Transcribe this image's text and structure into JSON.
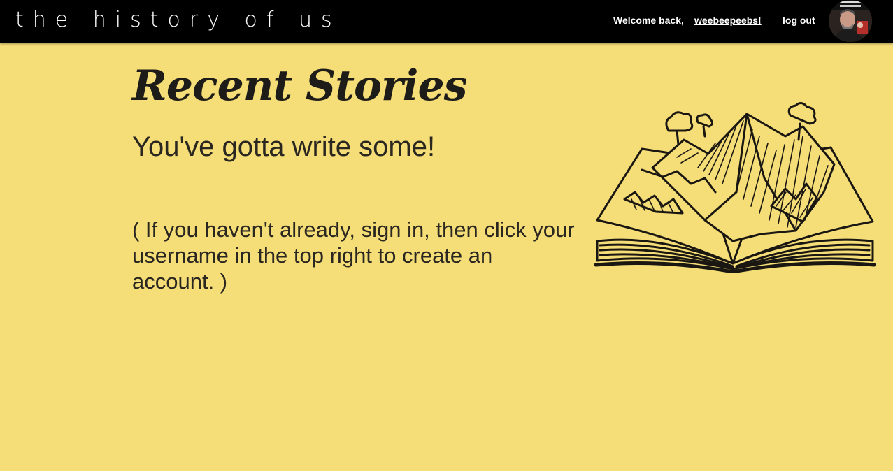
{
  "header": {
    "brand": "the history of us",
    "welcome_text": "Welcome back,",
    "username": "weebeepeebs!",
    "logout_label": "log out",
    "avatar_alt": "user avatar"
  },
  "main": {
    "title": "Recent Stories",
    "empty_message": "You've gotta write some!",
    "hint": "( If you haven't already, sign in, then click your username in the top right to create an account. )"
  },
  "colors": {
    "background": "#f5dd78",
    "topbar": "#000000",
    "text": "#222222"
  },
  "icons": {
    "illustration": "open-book-mountains-illustration",
    "avatar": "user-avatar-photo"
  }
}
